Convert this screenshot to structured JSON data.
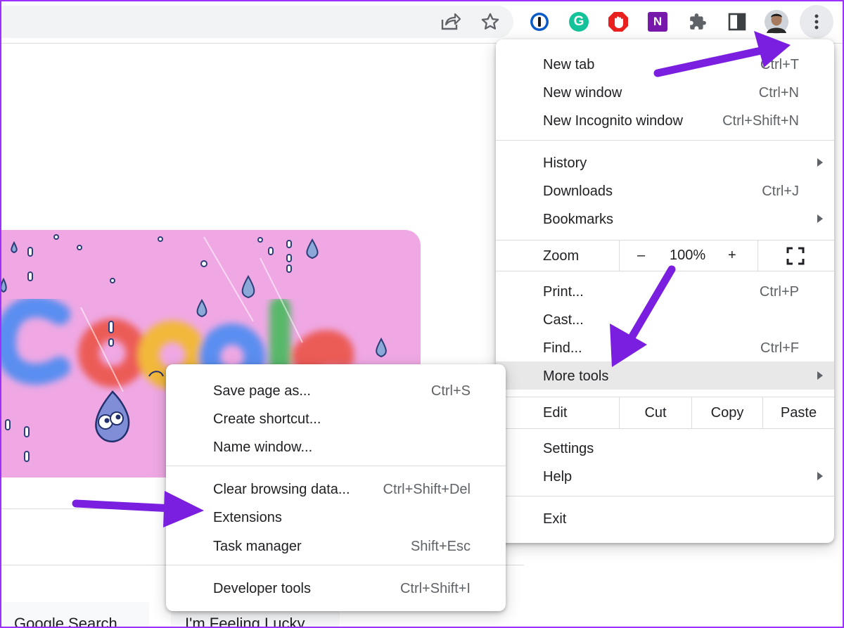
{
  "toolbar": {
    "icons": [
      "share-icon",
      "star-icon",
      "1password-icon",
      "grammarly-icon",
      "adblock-icon",
      "onenote-icon",
      "extensions-puzzle-icon",
      "side-panel-icon",
      "profile-avatar",
      "more-vert-icon"
    ],
    "grammarly_letter": "G",
    "onenote_letter": "N"
  },
  "page": {
    "google_search_label": "Google Search",
    "feeling_lucky_label": "I'm Feeling Lucky"
  },
  "main_menu": {
    "new_tab": {
      "label": "New tab",
      "shortcut": "Ctrl+T"
    },
    "new_window": {
      "label": "New window",
      "shortcut": "Ctrl+N"
    },
    "new_incognito": {
      "label": "New Incognito window",
      "shortcut": "Ctrl+Shift+N"
    },
    "history": {
      "label": "History"
    },
    "downloads": {
      "label": "Downloads",
      "shortcut": "Ctrl+J"
    },
    "bookmarks": {
      "label": "Bookmarks"
    },
    "zoom": {
      "label": "Zoom",
      "minus": "–",
      "value": "100%",
      "plus": "+"
    },
    "print": {
      "label": "Print...",
      "shortcut": "Ctrl+P"
    },
    "cast": {
      "label": "Cast..."
    },
    "find": {
      "label": "Find...",
      "shortcut": "Ctrl+F"
    },
    "more_tools": {
      "label": "More tools"
    },
    "edit": {
      "label": "Edit",
      "cut": "Cut",
      "copy": "Copy",
      "paste": "Paste"
    },
    "settings": {
      "label": "Settings"
    },
    "help": {
      "label": "Help"
    },
    "exit": {
      "label": "Exit"
    }
  },
  "sub_menu": {
    "save_page": {
      "label": "Save page as...",
      "shortcut": "Ctrl+S"
    },
    "create_shortcut": {
      "label": "Create shortcut..."
    },
    "name_window": {
      "label": "Name window..."
    },
    "clear_browsing": {
      "label": "Clear browsing data...",
      "shortcut": "Ctrl+Shift+Del"
    },
    "extensions": {
      "label": "Extensions"
    },
    "task_manager": {
      "label": "Task manager",
      "shortcut": "Shift+Esc"
    },
    "developer_tools": {
      "label": "Developer tools",
      "shortcut": "Ctrl+Shift+I"
    }
  },
  "colors": {
    "annotation_arrow": "#7a1fe0",
    "doodle_bg": "#efa8e4",
    "menu_highlight": "#e8e8e8"
  }
}
